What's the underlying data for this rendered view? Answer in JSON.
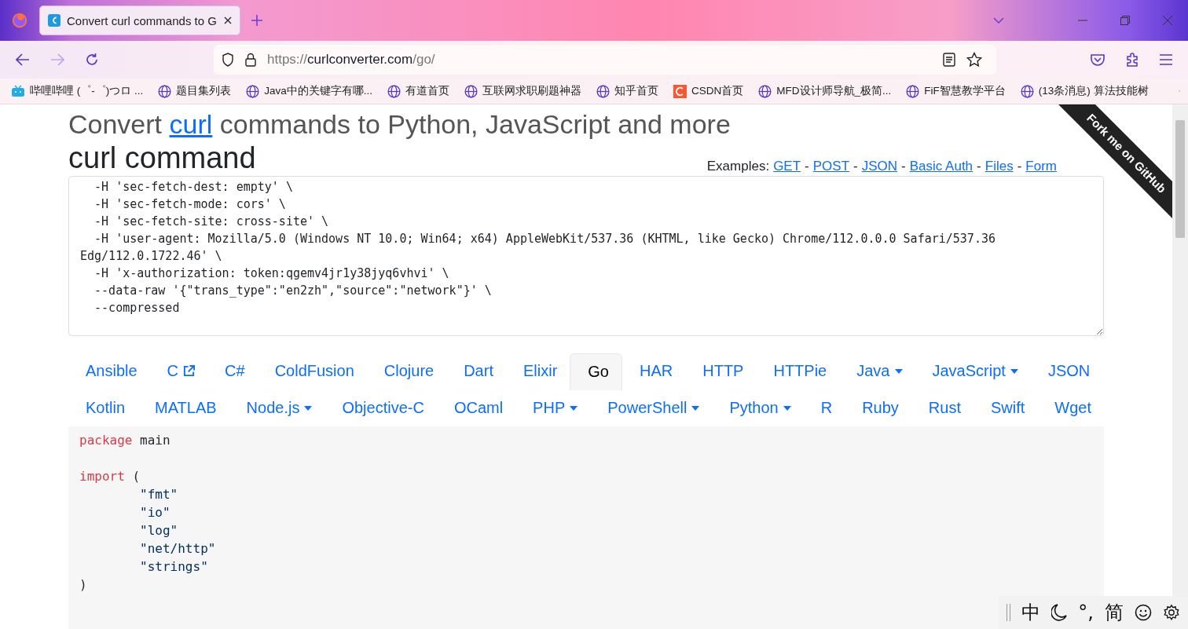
{
  "browser": {
    "tab_title": "Convert curl commands to G",
    "url_scheme": "https://",
    "url_host": "curlconverter.com",
    "url_path": "/go/",
    "bookmarks": [
      {
        "label": "哔哩哔哩 (゜-゜)つロ ...",
        "kind": "tv"
      },
      {
        "label": "题目集列表",
        "kind": "globe"
      },
      {
        "label": "Java中的关键字有哪...",
        "kind": "globe"
      },
      {
        "label": "有道首页",
        "kind": "globe"
      },
      {
        "label": "互联网求职刷题神器",
        "kind": "globe"
      },
      {
        "label": "知乎首页",
        "kind": "globe"
      },
      {
        "label": "CSDN首页",
        "kind": "logo"
      },
      {
        "label": "MFD设计师导航_极简...",
        "kind": "globe"
      },
      {
        "label": "FiF智慧教学平台",
        "kind": "globe"
      },
      {
        "label": "(13条消息) 算法技能树",
        "kind": "globe"
      }
    ]
  },
  "page": {
    "title_before": "Convert",
    "title_link": "curl",
    "title_after": "commands to Python, JavaScript and more",
    "section_heading": "curl command",
    "examples_label": "Examples:",
    "example_separator": "-",
    "examples": [
      "GET",
      "POST",
      "JSON",
      "Basic Auth",
      "Files",
      "Form"
    ],
    "fork_ribbon": "Fork me on GitHub",
    "curl_command": "  -H 'sec-fetch-dest: empty' \\\n  -H 'sec-fetch-mode: cors' \\\n  -H 'sec-fetch-site: cross-site' \\\n  -H 'user-agent: Mozilla/5.0 (Windows NT 10.0; Win64; x64) AppleWebKit/537.36 (KHTML, like Gecko) Chrome/112.0.0.0 Safari/537.36 Edg/112.0.1722.46' \\\n  -H 'x-authorization: token:qgemv4jr1y38jyq6vhvi' \\\n  --data-raw '{\"trans_type\":\"en2zh\",\"source\":\"network\"}' \\\n  --compressed",
    "language_tab_rows": [
      [
        {
          "label": "Ansible",
          "kind": "link",
          "selected": false
        },
        {
          "label": "C",
          "kind": "external",
          "selected": false
        },
        {
          "label": "C#",
          "kind": "link",
          "selected": false
        },
        {
          "label": "ColdFusion",
          "kind": "link",
          "selected": false
        },
        {
          "label": "Clojure",
          "kind": "link",
          "selected": false
        },
        {
          "label": "Dart",
          "kind": "link",
          "selected": false
        },
        {
          "label": "Elixir",
          "kind": "link",
          "selected": false
        },
        {
          "label": "Go",
          "kind": "link",
          "selected": true
        },
        {
          "label": "HAR",
          "kind": "link",
          "selected": false
        },
        {
          "label": "HTTP",
          "kind": "link",
          "selected": false
        },
        {
          "label": "HTTPie",
          "kind": "link",
          "selected": false
        },
        {
          "label": "Java",
          "kind": "dropdown",
          "selected": false
        },
        {
          "label": "JavaScript",
          "kind": "dropdown",
          "selected": false
        },
        {
          "label": "JSON",
          "kind": "link",
          "selected": false
        }
      ],
      [
        {
          "label": "Kotlin",
          "kind": "link",
          "selected": false
        },
        {
          "label": "MATLAB",
          "kind": "link",
          "selected": false
        },
        {
          "label": "Node.js",
          "kind": "dropdown",
          "selected": false
        },
        {
          "label": "Objective-C",
          "kind": "link",
          "selected": false
        },
        {
          "label": "OCaml",
          "kind": "link",
          "selected": false
        },
        {
          "label": "PHP",
          "kind": "dropdown",
          "selected": false
        },
        {
          "label": "PowerShell",
          "kind": "dropdown",
          "selected": false
        },
        {
          "label": "Python",
          "kind": "dropdown",
          "selected": false
        },
        {
          "label": "R",
          "kind": "link",
          "selected": false
        },
        {
          "label": "Ruby",
          "kind": "link",
          "selected": false
        },
        {
          "label": "Rust",
          "kind": "link",
          "selected": false
        },
        {
          "label": "Swift",
          "kind": "link",
          "selected": false
        },
        {
          "label": "Wget",
          "kind": "link",
          "selected": false
        }
      ]
    ],
    "code_blocks": [
      [
        [
          {
            "kind": "keyword",
            "text": "package"
          },
          {
            "kind": "plain",
            "text": " main"
          }
        ]
      ],
      [
        [
          {
            "kind": "keyword",
            "text": "import"
          },
          {
            "kind": "plain",
            "text": " ("
          }
        ],
        [
          {
            "kind": "string",
            "text": "        \"fmt\""
          }
        ],
        [
          {
            "kind": "string",
            "text": "        \"io\""
          }
        ],
        [
          {
            "kind": "string",
            "text": "        \"log\""
          }
        ],
        [
          {
            "kind": "string",
            "text": "        \"net/http\""
          }
        ],
        [
          {
            "kind": "string",
            "text": "        \"strings\""
          }
        ],
        [
          {
            "kind": "plain",
            "text": ")"
          }
        ]
      ]
    ]
  },
  "ime_toolbar": {
    "mode": "中",
    "punctuation": "°,",
    "script": "简"
  }
}
